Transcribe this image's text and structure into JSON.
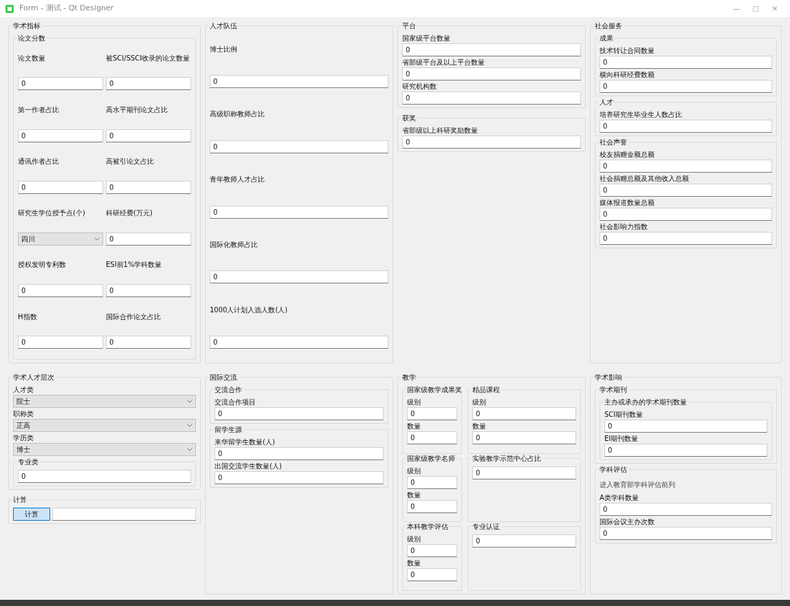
{
  "window": {
    "title": "Form - 测试 - Qt Designer",
    "controls": [
      "—",
      "□",
      "✕"
    ]
  },
  "sections": [
    {
      "kind": "group",
      "title": "学术指标",
      "items": [
        {
          "kind": "grid",
          "title": "论文分数",
          "items": [
            {
              "kind": "field",
              "label": "论文数量",
              "value": "0"
            },
            {
              "kind": "field",
              "label": "被SCI/SSCI收录的论文数量",
              "value": "0"
            },
            {
              "kind": "field",
              "label": "第一作者占比",
              "value": "0"
            },
            {
              "kind": "field",
              "label": "高水平期刊论文占比",
              "value": "0"
            },
            {
              "kind": "field",
              "label": "通讯作者占比",
              "value": "0"
            },
            {
              "kind": "field",
              "label": "高被引论文占比",
              "value": "0"
            },
            {
              "kind": "combo",
              "label": "研究生学位授予点(个)",
              "value": "四川"
            },
            {
              "kind": "field",
              "label": "科研经费(万元)",
              "value": "0"
            },
            {
              "kind": "field",
              "label": "授权发明专利数",
              "value": "0"
            },
            {
              "kind": "field",
              "label": "ESI前1%学科数量",
              "value": "0"
            },
            {
              "kind": "field",
              "label": "H指数",
              "value": "0"
            },
            {
              "kind": "field",
              "label": "国际合作论文占比",
              "value": "0"
            }
          ]
        }
      ]
    },
    {
      "kind": "stack",
      "title": "人才队伍",
      "items": [
        {
          "kind": "field",
          "label": "博士比例",
          "value": "0"
        },
        {
          "kind": "field",
          "label": "高级职称教师占比",
          "value": "0"
        },
        {
          "kind": "field",
          "label": "青年教师人才占比",
          "value": "0"
        },
        {
          "kind": "field",
          "label": "国际化教师占比",
          "value": "0"
        },
        {
          "kind": "field",
          "label": "1000人计划入选人数(人)",
          "value": "0"
        }
      ]
    },
    {
      "kind": "plain",
      "items": [
        {
          "kind": "group",
          "title": "平台",
          "items": [
            {
              "kind": "field",
              "label": "国家级平台数量",
              "value": "0"
            },
            {
              "kind": "field",
              "label": "省部级平台及以上平台数量",
              "value": "0"
            },
            {
              "kind": "field",
              "label": "研究机构数",
              "value": "0"
            }
          ]
        },
        {
          "kind": "group",
          "title": "获奖",
          "items": [
            {
              "kind": "field",
              "label": "省部级以上科研奖励数量",
              "value": "0"
            }
          ]
        }
      ]
    },
    {
      "kind": "group",
      "title": "社会服务",
      "items": [
        {
          "kind": "group",
          "title": "成果",
          "items": [
            {
              "kind": "field",
              "label": "技术转让合同数量",
              "value": "0"
            },
            {
              "kind": "field",
              "label": "横向科研经费数额",
              "value": "0"
            }
          ]
        },
        {
          "kind": "group",
          "title": "人才",
          "items": [
            {
              "kind": "field",
              "label": "培养研究生毕业生人数占比",
              "value": "0"
            }
          ]
        },
        {
          "kind": "group",
          "title": "社会声誉",
          "items": [
            {
              "kind": "field",
              "label": "校友捐赠金额总额",
              "value": "0"
            },
            {
              "kind": "field",
              "label": "社会捐赠总额及其他收入总额",
              "value": "0"
            },
            {
              "kind": "field",
              "label": "媒体报道数量总额",
              "value": "0"
            },
            {
              "kind": "field",
              "label": "社会影响力指数",
              "value": "0"
            }
          ]
        }
      ]
    },
    {
      "kind": "plain",
      "items": [
        {
          "kind": "group",
          "title": "学术人才层次",
          "items": [
            {
              "kind": "combo",
              "label": "人才类",
              "value": "院士"
            },
            {
              "kind": "combo",
              "label": "职称类",
              "value": "正高"
            },
            {
              "kind": "combo",
              "label": "学历类",
              "value": "博士"
            },
            {
              "kind": "group",
              "title": "专业类",
              "items": [
                {
                  "kind": "field",
                  "value": "0"
                }
              ]
            }
          ]
        },
        {
          "kind": "group",
          "title": "计算",
          "items": [
            {
              "kind": "button_field",
              "button": "计算",
              "value": ""
            }
          ]
        }
      ]
    },
    {
      "kind": "group",
      "title": "国际交流",
      "items": [
        {
          "kind": "group",
          "title": "交流合作",
          "items": [
            {
              "kind": "field",
              "label": "交流合作项目",
              "value": "0"
            }
          ]
        },
        {
          "kind": "group",
          "title": "留学生源",
          "items": [
            {
              "kind": "field",
              "label": "来华留学生数量(人)",
              "value": "0"
            },
            {
              "kind": "field",
              "label": "出国交流学生数量(人)",
              "value": "0"
            }
          ]
        }
      ]
    },
    {
      "kind": "group",
      "title": "教学",
      "items": [
        {
          "kind": "cells",
          "items": [
            {
              "kind": "group",
              "title": "国家级教学成果奖",
              "items": [
                {
                  "kind": "field",
                  "label": "级别",
                  "value": "0"
                },
                {
                  "kind": "field",
                  "label": "数量",
                  "value": "0"
                }
              ]
            },
            {
              "kind": "group",
              "title": "精品课程",
              "items": [
                {
                  "kind": "field",
                  "label": "级别",
                  "value": "0"
                },
                {
                  "kind": "field",
                  "label": "数量",
                  "value": "0"
                }
              ]
            },
            {
              "kind": "group",
              "title": "国家级教学名师",
              "items": [
                {
                  "kind": "field",
                  "label": "级别",
                  "value": "0"
                },
                {
                  "kind": "field",
                  "label": "数量",
                  "value": "0"
                }
              ]
            },
            {
              "kind": "group",
              "title": "实验教学示范中心占比",
              "items": [
                {
                  "kind": "field",
                  "value": "0"
                }
              ]
            },
            {
              "kind": "group",
              "title": "本科教学评估",
              "items": [
                {
                  "kind": "field",
                  "label": "级别",
                  "value": "0"
                },
                {
                  "kind": "field",
                  "label": "数量",
                  "value": "0"
                }
              ]
            },
            {
              "kind": "group",
              "title": "专业认证",
              "items": [
                {
                  "kind": "field",
                  "value": "0"
                }
              ]
            }
          ]
        }
      ]
    },
    {
      "kind": "group",
      "title": "学术影响",
      "items": [
        {
          "kind": "group",
          "title": "学术期刊",
          "items": [
            {
              "kind": "group",
              "title": "主办或承办的学术期刊数量",
              "items": [
                {
                  "kind": "field",
                  "label": "SCI期刊数量",
                  "value": "0"
                },
                {
                  "kind": "field",
                  "label": "EI期刊数量",
                  "value": "0"
                }
              ]
            }
          ]
        },
        {
          "kind": "group",
          "title": "学科评估",
          "items": [
            {
              "kind": "note",
              "text": "进入教育部学科评估前列"
            },
            {
              "kind": "field",
              "label": "A类学科数量",
              "value": "0"
            },
            {
              "kind": "field",
              "label": "国际会议主办次数",
              "value": "0"
            }
          ]
        }
      ]
    }
  ]
}
